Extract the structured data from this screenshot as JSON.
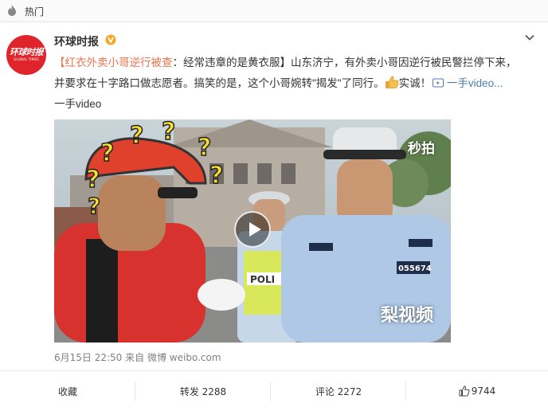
{
  "topbar": {
    "label": "热门",
    "icon": "flame-icon"
  },
  "post": {
    "username": "环球时报",
    "avatar_text": "环球时报",
    "avatar_subtext": "GLOBAL TIMES",
    "text_link": "【红衣外卖小哥逆行被查",
    "text_link_end": "：经常违章的是黄衣服】",
    "text_body1": "山东济宁，有外卖小哥因逆行被民警拦停下来，",
    "text_body2": "并要求在十字路口做志愿者。搞笑的是，这个小哥婉转\"揭发\"了同行。",
    "text_after_emoji": "实诚！",
    "video_link": "一手video...",
    "text_line3": "一手video",
    "watermark_miaopai": "秒拍",
    "watermark_lishipin": "梨视频",
    "police_badge_number": "055674",
    "police_vest_text": "POLI",
    "timestamp": "6月15日 22:50",
    "source_prefix": "来自",
    "source": "微博 weibo.com"
  },
  "actions": {
    "favorite": "收藏",
    "repost": "转发 2288",
    "comment": "评论 2272",
    "like": "9744"
  },
  "colors": {
    "accent_link": "#eb7350",
    "link_blue": "#507daf",
    "brand_red": "#e0242b",
    "verified_gold": "#f5a623"
  }
}
